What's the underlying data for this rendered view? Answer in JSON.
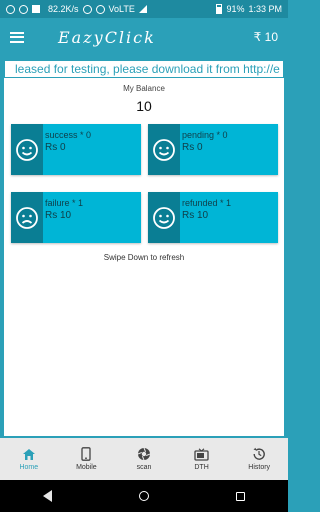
{
  "status_bar": {
    "speed": "82.2K/s",
    "network": "VoLTE",
    "battery": "91%",
    "time": "1:33 PM"
  },
  "app_bar": {
    "logo": "EazyClick",
    "balance": "₹ 10"
  },
  "ticker": {
    "text": "leased for testing, please download it from http://e"
  },
  "balance": {
    "label": "My Balance",
    "value": "10"
  },
  "cards": [
    {
      "title": "success * 0",
      "value": "Rs 0",
      "face": "happy-face-icon"
    },
    {
      "title": "pending * 0",
      "value": "Rs 0",
      "face": "happy-face-icon"
    },
    {
      "title": "failure * 1",
      "value": "Rs 10",
      "face": "sad-face-icon"
    },
    {
      "title": "refunded * 1",
      "value": "Rs 10",
      "face": "happy-face-icon"
    }
  ],
  "swipe_hint": "Swipe Down to refresh",
  "bottom_nav": [
    {
      "label": "Home",
      "icon": "home-icon",
      "active": true
    },
    {
      "label": "Mobile",
      "icon": "mobile-icon",
      "active": false
    },
    {
      "label": "scan",
      "icon": "aperture-icon",
      "active": false
    },
    {
      "label": "DTH",
      "icon": "tv-icon",
      "active": false
    },
    {
      "label": "History",
      "icon": "history-icon",
      "active": false
    }
  ],
  "colors": {
    "primary": "#2ba0b8",
    "card": "#00b5d6",
    "card_face": "#0a7e94"
  }
}
